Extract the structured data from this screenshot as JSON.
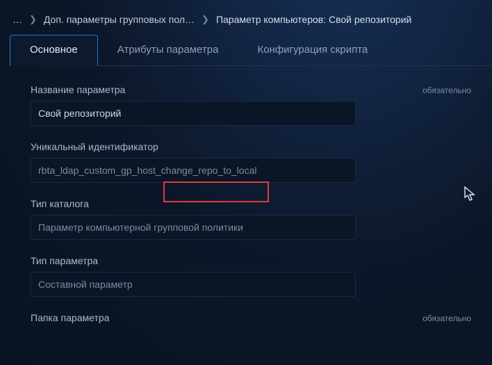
{
  "breadcrumb": {
    "ellipsis": "…",
    "item1": "Доп. параметры групповых пол…",
    "current": "Параметр компьютеров: Свой репозиторий"
  },
  "tabs": {
    "t1": "Основное",
    "t2": "Атрибуты параметра",
    "t3": "Конфигурация скрипта"
  },
  "labels": {
    "name": "Название параметра",
    "uid": "Уникальный идентификатор",
    "catalog_type": "Тип каталога",
    "param_type": "Тип параметра",
    "folder": "Папка параметра",
    "required": "обязательно"
  },
  "values": {
    "name": "Свой репозиторий",
    "uid": "rbta_ldap_custom_gp_host_change_repo_to_local",
    "catalog_type": "Параметр компьютерной групповой политики",
    "param_type": "Составной параметр"
  }
}
